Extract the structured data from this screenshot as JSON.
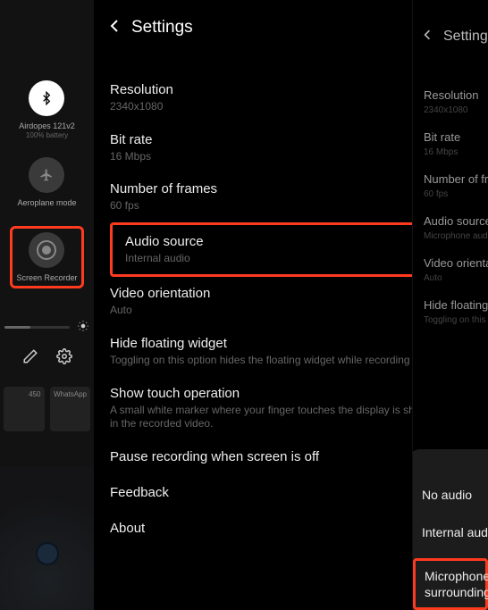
{
  "sidebar": {
    "tiles": [
      {
        "label": "Airdopes 121v2",
        "sublabel": "100% battery",
        "icon": "bluetooth",
        "on": true
      },
      {
        "label": "Aeroplane mode",
        "sublabel": "",
        "icon": "airplane",
        "on": false
      },
      {
        "label": "Screen Recorder",
        "sublabel": "",
        "icon": "record",
        "on": false
      }
    ],
    "preview_labels": [
      "450",
      "WhatsApp"
    ]
  },
  "main": {
    "title": "Settings",
    "items": [
      {
        "title": "Resolution",
        "sub": "2340x1080"
      },
      {
        "title": "Bit rate",
        "sub": "16 Mbps"
      },
      {
        "title": "Number of frames",
        "sub": "60 fps"
      },
      {
        "title": "Audio source",
        "sub": "Internal audio"
      },
      {
        "title": "Video orientation",
        "sub": "Auto"
      },
      {
        "title": "Hide floating widget",
        "sub": "Toggling on this option hides the floating widget while recording"
      },
      {
        "title": "Show touch operation",
        "sub": "A small white marker where your finger touches the display is shown in the recorded video."
      },
      {
        "title": "Pause recording when screen is off",
        "sub": ""
      },
      {
        "title": "Feedback",
        "sub": ""
      },
      {
        "title": "About",
        "sub": ""
      }
    ]
  },
  "peek": {
    "title": "Settings",
    "items": [
      {
        "title": "Resolution",
        "sub": "2340x1080"
      },
      {
        "title": "Bit rate",
        "sub": "16 Mbps"
      },
      {
        "title": "Number of frames",
        "sub": "60 fps"
      },
      {
        "title": "Audio source",
        "sub": "Microphone audio"
      },
      {
        "title": "Video orientation",
        "sub": "Auto"
      },
      {
        "title": "Hide floating widget",
        "sub": "Toggling on this option"
      }
    ]
  },
  "popup": {
    "items": [
      "No audio",
      "Internal audio"
    ],
    "highlighted": [
      "Microphone",
      "surrounding"
    ]
  }
}
